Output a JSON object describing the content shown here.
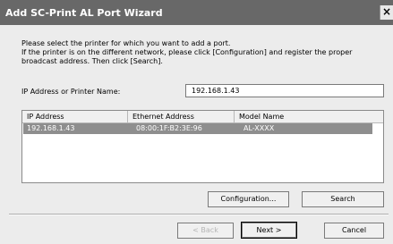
{
  "window": {
    "title": "Add SC-Print AL Port Wizard",
    "close_glyph": "×"
  },
  "instructions": {
    "line1": "Please select the printer for which you want to add a port.",
    "line2": "If the printer is on the different network, please click [Configuration] and register the proper",
    "line3": "broadcast address. Then click [Search]."
  },
  "ip_field": {
    "label": "IP Address or Printer Name:",
    "value": "192.168.1.43"
  },
  "printer_list": {
    "columns": [
      "IP Address",
      "Ethernet Address",
      "Model Name"
    ],
    "rows": [
      {
        "ip": "192.168.1.43",
        "mac": "08:00:1F:B2:3E:96",
        "model": "AL-XXXX",
        "selected": true
      }
    ]
  },
  "buttons": {
    "configuration": "Configuration...",
    "search": "Search",
    "back": "< Back",
    "next": "Next >",
    "cancel": "Cancel"
  },
  "colors": {
    "titlebar": "#686868",
    "selection": "#8e8e8e",
    "dialog": "#ececec"
  }
}
